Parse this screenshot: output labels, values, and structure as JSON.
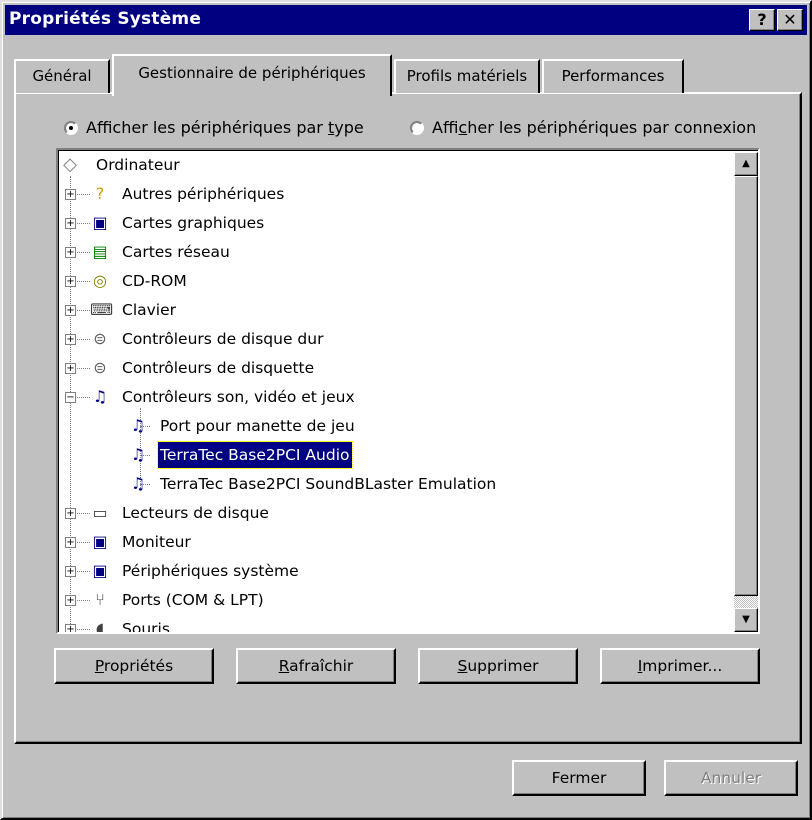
{
  "window": {
    "title": "Propriétés Système",
    "help_label": "?",
    "close_label": "✕"
  },
  "tabs": [
    {
      "label": "Général"
    },
    {
      "label": "Gestionnaire de périphériques"
    },
    {
      "label": "Profils matériels"
    },
    {
      "label": "Performances"
    }
  ],
  "radios": {
    "by_type": {
      "pre": "Afficher les périphériques par ",
      "u": "t",
      "post": "ype",
      "checked": true
    },
    "by_connection": {
      "pre": "Affi",
      "u": "c",
      "post": "her les périphériques par connexion",
      "checked": false
    }
  },
  "tree": {
    "root": {
      "label": "Ordinateur",
      "icon": "computer-diamond-icon"
    },
    "items": [
      {
        "label": "Autres périphériques",
        "icon": "question-icon",
        "expander": "+"
      },
      {
        "label": "Cartes graphiques",
        "icon": "monitor-icon",
        "expander": "+"
      },
      {
        "label": "Cartes réseau",
        "icon": "network-card-icon",
        "expander": "+"
      },
      {
        "label": "CD-ROM",
        "icon": "cdrom-icon",
        "expander": "+"
      },
      {
        "label": "Clavier",
        "icon": "keyboard-icon",
        "expander": "+"
      },
      {
        "label": "Contrôleurs de disque dur",
        "icon": "disk-controller-icon",
        "expander": "+"
      },
      {
        "label": "Contrôleurs de disquette",
        "icon": "floppy-controller-icon",
        "expander": "+"
      },
      {
        "label": "Contrôleurs son, vidéo et jeux",
        "icon": "sound-card-icon",
        "expander": "-"
      },
      {
        "label": "Port pour manette de jeu",
        "icon": "sound-card-icon",
        "child": true
      },
      {
        "label": "TerraTec Base2PCI Audio",
        "icon": "sound-card-icon",
        "child": true,
        "selected": true
      },
      {
        "label": "TerraTec Base2PCI SoundBLaster Emulation",
        "icon": "sound-card-icon",
        "child": true
      },
      {
        "label": "Lecteurs de disque",
        "icon": "disk-drive-icon",
        "expander": "+"
      },
      {
        "label": "Moniteur",
        "icon": "monitor-icon",
        "expander": "+"
      },
      {
        "label": "Périphériques système",
        "icon": "system-device-icon",
        "expander": "+"
      },
      {
        "label": "Ports (COM & LPT)",
        "icon": "port-icon",
        "expander": "+"
      },
      {
        "label": "Souris",
        "icon": "mouse-icon",
        "expander": "+"
      }
    ]
  },
  "actions": {
    "properties": {
      "u": "P",
      "rest": "ropriétés"
    },
    "refresh": {
      "u": "R",
      "rest": "afraîchir"
    },
    "remove": {
      "u": "S",
      "rest": "upprimer"
    },
    "print": {
      "u": "I",
      "rest": "mprimer..."
    }
  },
  "footer": {
    "close": "Fermer",
    "cancel": "Annuler"
  },
  "colors": {
    "selection": "#000080",
    "face": "#c0c0c0",
    "title_bar": "#000080"
  }
}
